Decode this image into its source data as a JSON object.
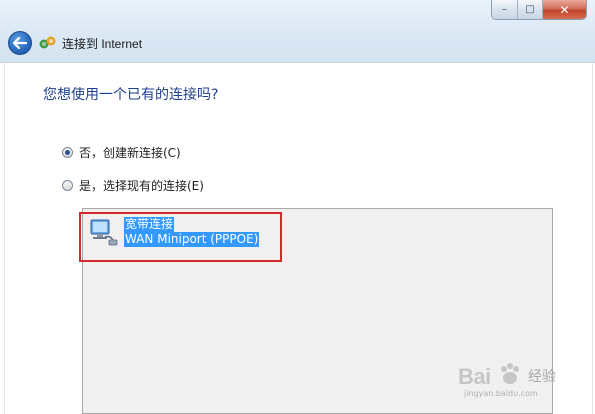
{
  "window": {
    "title": "连接到 Internet",
    "controls": {
      "minimize": "–",
      "maximize": "□",
      "close": "✕"
    }
  },
  "page": {
    "heading": "您想使用一个已有的连接吗?",
    "options": [
      {
        "label": "否，创建新连接(C)",
        "selected": true
      },
      {
        "label": "是，选择现有的连接(E)",
        "selected": false
      }
    ],
    "connections": [
      {
        "name": "宽带连接",
        "device": "WAN Miniport (PPPOE)",
        "icon": "network-connection-icon",
        "selected": true
      }
    ]
  },
  "watermark": {
    "brand_left": "Bai",
    "brand_right": "经验",
    "url": "jingyan.baidu.com",
    "icon": "paw-icon"
  },
  "colors": {
    "heading": "#1f3f8f",
    "selection": "#3399ff",
    "annotation": "#d32b2b"
  }
}
